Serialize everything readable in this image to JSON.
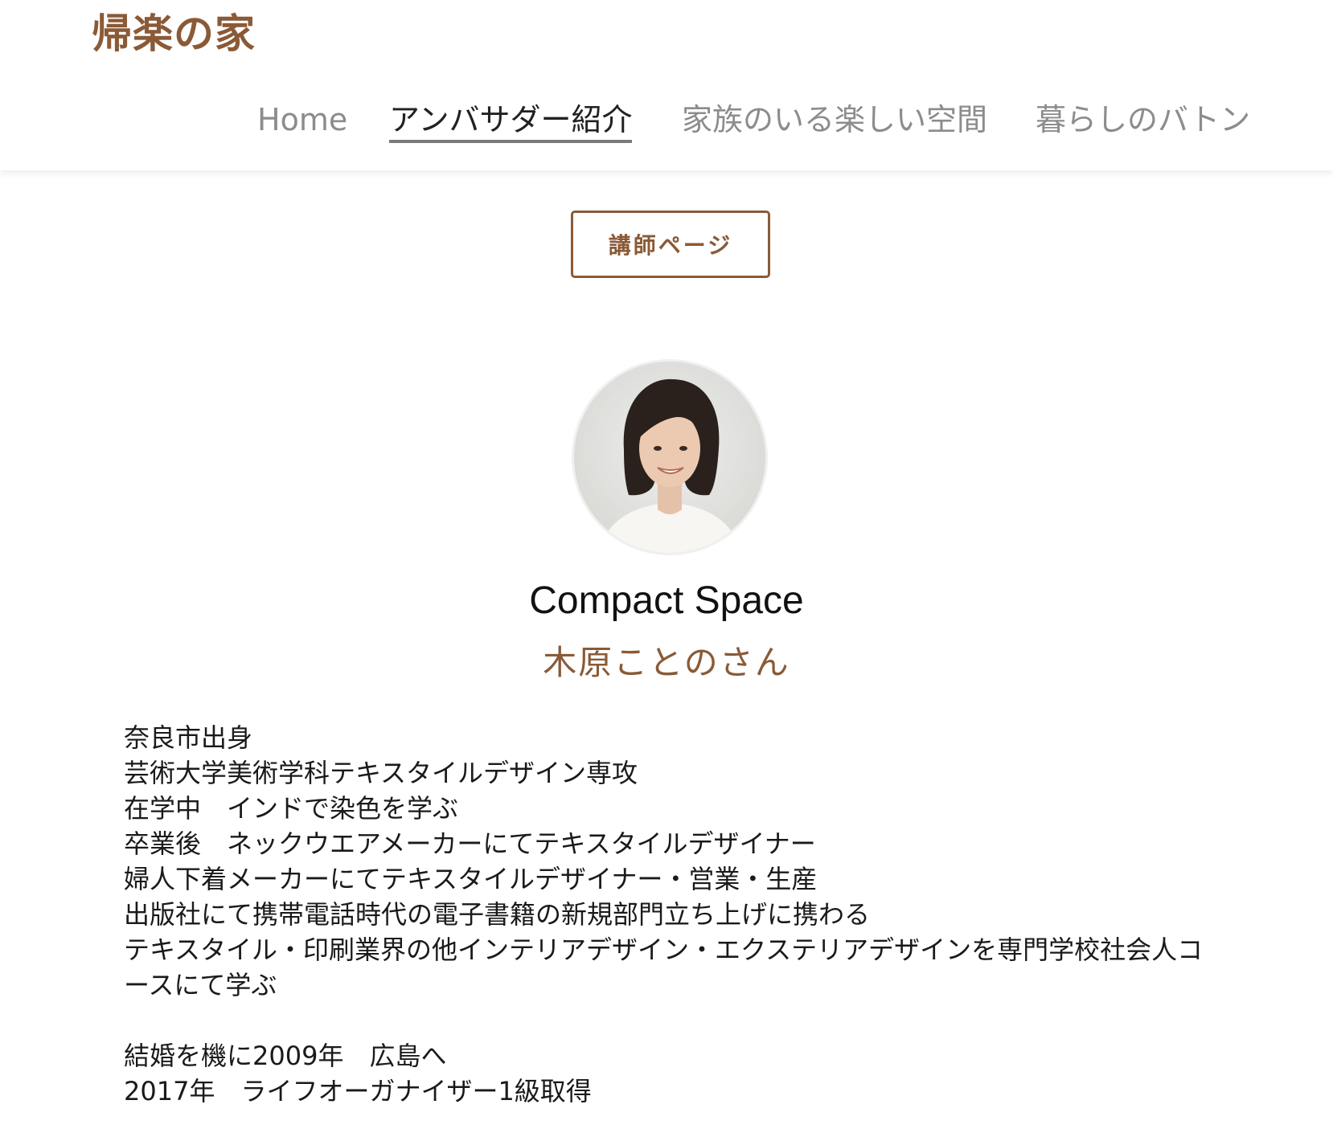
{
  "header": {
    "logo": "帰楽の家",
    "nav": [
      {
        "label": "Home"
      },
      {
        "label": "アンバサダー紹介"
      },
      {
        "label": "家族のいる楽しい空間"
      },
      {
        "label": "暮らしのバトン"
      }
    ],
    "active_nav": "アンバサダー紹介"
  },
  "main": {
    "instructor_button": "講師ページ",
    "company": "Compact Space",
    "person": "木原ことのさん",
    "bio": [
      "奈良市出身",
      "芸術大学美術学科テキスタイルデザイン専攻",
      "在学中　インドで染色を学ぶ",
      "卒業後　ネックウエアメーカーにてテキスタイルデザイナー",
      "婦人下着メーカーにてテキスタイルデザイナー・営業・生産",
      "出版社にて携帯電話時代の電子書籍の新規部門立ち上げに携わる",
      "テキスタイル・印刷業界の他インテリアデザイン・エクステリアデザインを専門学校社会人コースにて学ぶ"
    ],
    "bio2": [
      "結婚を機に2009年　広島へ",
      "2017年　ライフオーガナイザー1級取得"
    ]
  },
  "colors": {
    "brand": "#8a5a36",
    "nav_inactive": "#8c8c8c",
    "nav_active": "#222222"
  }
}
